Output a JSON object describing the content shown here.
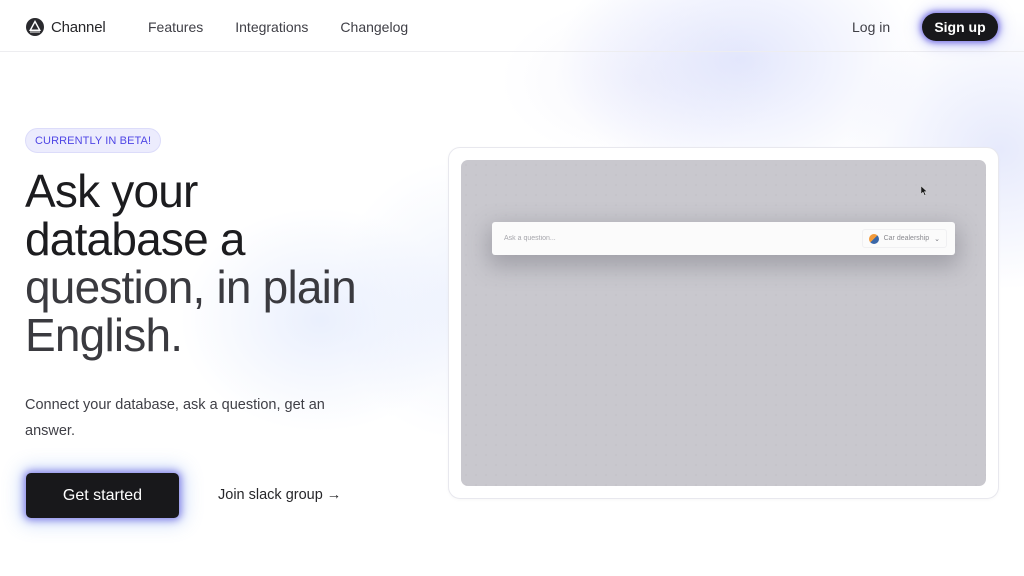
{
  "nav": {
    "brand": "Channel",
    "links": [
      "Features",
      "Integrations",
      "Changelog"
    ],
    "login": "Log in",
    "signup": "Sign up"
  },
  "hero": {
    "badge": "CURRENTLY IN BETA!",
    "headline_lines": [
      "Ask your",
      "database a",
      "question, in plain",
      "English."
    ],
    "subtext": "Connect your database, ask a question, get an answer.",
    "cta": "Get started",
    "secondary_link": "Join slack group →"
  },
  "preview": {
    "ask_placeholder": "Ask a question...",
    "database_selected": "Car dealership",
    "chevron": "⌄"
  },
  "colors": {
    "accent": "#4f46e5",
    "button_dark": "#18181b",
    "badge_bg": "#ececfd",
    "preview_screen": "#c9c8ce"
  }
}
